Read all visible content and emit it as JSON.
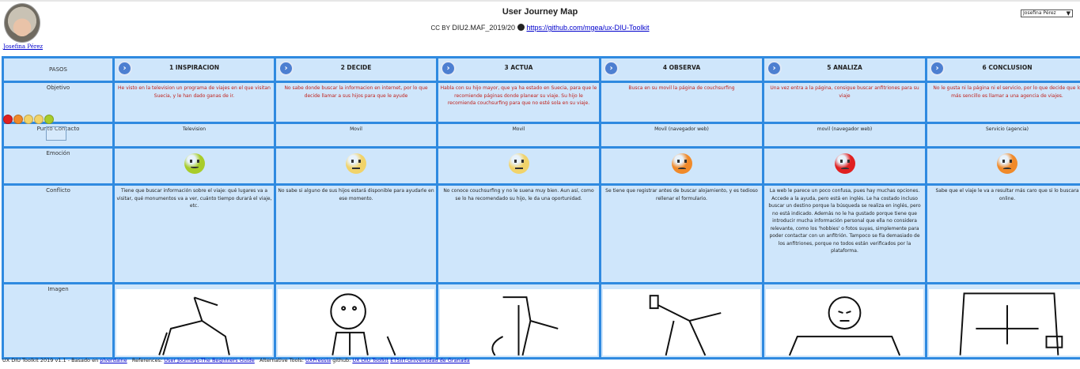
{
  "header": {
    "title": "User Journey Map",
    "license_prefix": "CC BY",
    "project": "DIU2.MAF_2019/20",
    "repo_link": "https://github.com/mgea/ux-DIU-Toolkit",
    "author_link": "Josefina Pérez",
    "user_select_value": "Josefina Pérez"
  },
  "rows": {
    "pasos": "PASOS",
    "objetivo": "Objetivo",
    "contacto": "Punto Contacto",
    "emocion": "Emoción",
    "conflicto": "Conflicto",
    "imagen": "Imagen"
  },
  "steps": [
    {
      "label": "1 INSPIRACION",
      "objetivo": "He visto en la television un programa de viajes en el que visitan Suecia, y le han dado ganas de ir.",
      "contacto": "Television",
      "emotion": "happy",
      "emotion_color": "#a8cc2a",
      "conflicto": "Tiene que buscar información sobre el viaje: qué lugares va a visitar, qué monumentos va a ver, cuánto tiempo durará el viaje, etc."
    },
    {
      "label": "2 DECIDE",
      "objetivo": "No sabe donde buscar la informacion en internet, por lo que decide llamar a sus hijos para que le ayude",
      "contacto": "Movil",
      "emotion": "neutral",
      "emotion_color": "#f1d36a",
      "conflicto": "No sabe si alguno de sus hijos estará disponible para ayudarle en ese momento."
    },
    {
      "label": "3 ACTUA",
      "objetivo": "Habla con su hijo mayor, que ya ha estado en Suecia, para que le recomiende páginas donde planear su viaje. Su hijo le recomienda couchsurfing para que no esté sola en su viaje.",
      "contacto": "Movil",
      "emotion": "neutral",
      "emotion_color": "#f1d36a",
      "conflicto": "No conoce couchsurfing y no le suena muy bien. Aun así, como se lo ha recomendado su hijo, le da una oportunidad."
    },
    {
      "label": "4 OBSERVA",
      "objetivo": "Busca en su movil la página de couchsurfing",
      "contacto": "Movil (navegador web)",
      "emotion": "sad",
      "emotion_color": "#f08a2a",
      "conflicto": "Se tiene que registrar antes de buscar alojamiento, y es tedioso rellenar el formulario."
    },
    {
      "label": "5 ANALIZA",
      "objetivo": "Una vez entra a la página, consigue buscar anfitriones para su viaje",
      "contacto": "movil (navegador web)",
      "emotion": "angry",
      "emotion_color": "#e02020",
      "conflicto": "La web le parece un poco confusa, pues hay muchas opciones. Accede a la ayuda, pero está en inglés. Le ha costado incluso buscar un destino porque la búsqueda se realiza en inglés, pero no está indicado. Además no le ha gustado porque tiene que introducir mucha información personal que ella no considera relevante, como los 'hobbies' o fotos suyas, simplemente para poder contactar con un anfitrión. Tampoco se fía demasiado de los anfitriones, porque no todos están verificados por la plataforma."
    },
    {
      "label": "6 CONCLUSION",
      "objetivo": "No le gusta ni la página ni el servicio, por lo que decide que lo más sencillo es llamar a una agencia de viajes.",
      "contacto": "Servicio (agencia)",
      "emotion": "sad",
      "emotion_color": "#f08a2a",
      "conflicto": "Sabe que el viaje le va a resultar más caro que si lo buscara online."
    }
  ],
  "legend_colors": [
    "#e02020",
    "#f08a2a",
    "#f1d36a",
    "#f1d36a",
    "#a8cc2a"
  ],
  "footer": {
    "prefix": "UX DIU Toolkit 2019 v1.1 - Basado en",
    "link1": "plverdaine",
    "refs_label": "References:",
    "link2": "User Journeys-The Beginners Guide",
    "alt_label": "Alternative Tools:",
    "link3": "UXPressia",
    "github_label": "github:",
    "link4": "UX DIU Toolkit",
    "link5": "ETSIIT-Universidad de Granada"
  }
}
